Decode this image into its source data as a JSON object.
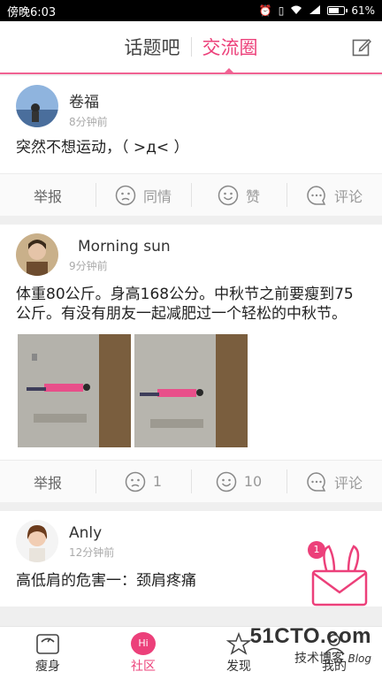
{
  "status": {
    "left": "傍晚6:03",
    "battery": "61%"
  },
  "header": {
    "tabs": [
      {
        "label": "话题吧",
        "active": false
      },
      {
        "label": "交流圈",
        "active": true
      }
    ]
  },
  "posts": [
    {
      "user": "卷福",
      "time": "8分钟前",
      "text": "突然不想运动，（ >д< ）",
      "actions": {
        "report": "举报",
        "sympathy": "同情",
        "like": "赞",
        "comment": "评论"
      }
    },
    {
      "user": "Morning sun",
      "time": "9分钟前",
      "text": "体重80公斤。身高168公分。中秋节之前要瘦到75公斤。有没有朋友一起减肥过一个轻松的中秋节。",
      "actions": {
        "report": "举报",
        "sympathy": "1",
        "like": "10",
        "comment": "评论"
      }
    },
    {
      "user": "Anly",
      "time": "12分钟前",
      "text": "高低肩的危害一：颈肩疼痛"
    }
  ],
  "message": {
    "badge": "1"
  },
  "bottom_nav": [
    {
      "label": "瘦身",
      "icon": "scale-icon"
    },
    {
      "label": "社区",
      "icon": "hi-bubble-icon",
      "badge_text": "Hi",
      "active": true
    },
    {
      "label": "发现",
      "icon": "discover-icon"
    },
    {
      "label": "我的",
      "icon": "profile-icon"
    }
  ],
  "watermark": {
    "line1": "51CTO.com",
    "line2": "技术博客",
    "line3": "Blog"
  },
  "colors": {
    "accent": "#ec407a"
  }
}
